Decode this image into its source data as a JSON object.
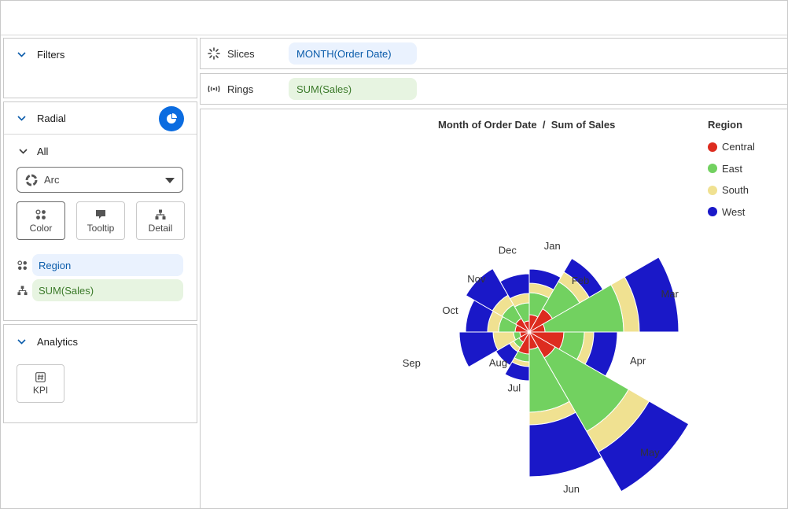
{
  "filters": {
    "label": "Filters"
  },
  "radial": {
    "label": "Radial",
    "all_label": "All",
    "mark_type": "Arc",
    "buttons": {
      "color": "Color",
      "tooltip": "Tooltip",
      "detail": "Detail"
    },
    "color_field": "Region",
    "detail_field": "SUM(Sales)"
  },
  "analytics": {
    "label": "Analytics",
    "kpi": "KPI"
  },
  "shelves": {
    "slices": {
      "label": "Slices",
      "field": "MONTH(Order Date)"
    },
    "rings": {
      "label": "Rings",
      "field": "SUM(Sales)"
    }
  },
  "colors": {
    "Central": "#dd2c1f",
    "East": "#72d160",
    "South": "#f0e191",
    "West": "#1a18c8",
    "accent": "#0b6ce0"
  },
  "chart_data": {
    "type": "radial-stacked-bar",
    "title": "Month of Order Date  /  Sum of Sales",
    "legend_title": "Region",
    "legend_position": "top-right",
    "categories": [
      "Jan",
      "Feb",
      "Mar",
      "Apr",
      "May",
      "Jun",
      "Jul",
      "Aug",
      "Sep",
      "Oct",
      "Nov",
      "Dec"
    ],
    "series": [
      {
        "name": "Central",
        "values": [
          22,
          34,
          20,
          44,
          38,
          22,
          28,
          15,
          12,
          18,
          20,
          14
        ]
      },
      {
        "name": "East",
        "values": [
          28,
          40,
          100,
          26,
          108,
          80,
          10,
          8,
          8,
          21,
          20,
          23
        ]
      },
      {
        "name": "South",
        "values": [
          12,
          14,
          20,
          12,
          30,
          16,
          6,
          6,
          26,
          14,
          14,
          12
        ]
      },
      {
        "name": "West",
        "values": [
          18,
          20,
          50,
          30,
          58,
          66,
          18,
          20,
          43,
          28,
          39,
          25
        ]
      }
    ]
  }
}
